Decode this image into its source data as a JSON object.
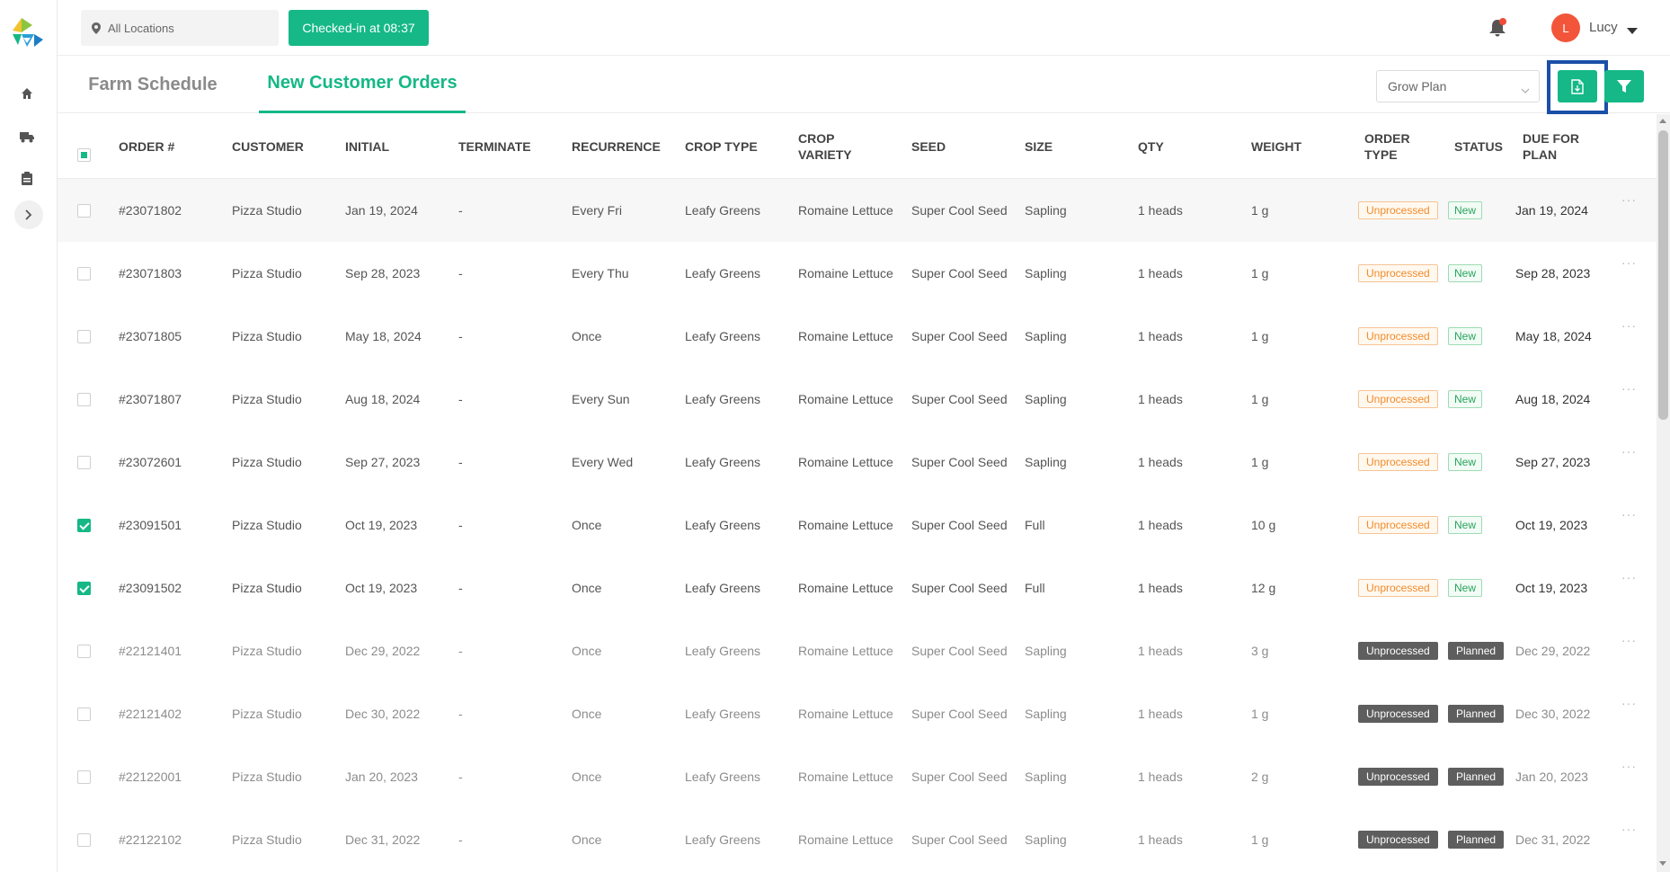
{
  "header": {
    "location_label": "All Locations",
    "checkin_label": "Checked-in at 08:37",
    "user_initial": "L",
    "user_name": "Lucy"
  },
  "tabs": [
    {
      "label": "Farm Schedule",
      "active": false
    },
    {
      "label": "New Customer Orders",
      "active": true
    }
  ],
  "toolbar": {
    "grow_plan_value": "Grow Plan"
  },
  "colors": {
    "accent": "#15b886",
    "highlight": "#1a4fa8",
    "unprocessed": "#f28c2b",
    "new": "#28a45c"
  },
  "table": {
    "headers": [
      "ORDER #",
      "CUSTOMER",
      "INITIAL",
      "TERMINATE",
      "RECURRENCE",
      "CROP TYPE",
      "CROP VARIETY",
      "SEED",
      "SIZE",
      "QTY",
      "WEIGHT",
      "ORDER TYPE",
      "STATUS",
      "DUE FOR PLAN"
    ],
    "rows": [
      {
        "order": "#23071802",
        "customer": "Pizza Studio",
        "initial": "Jan 19, 2024",
        "terminate": "-",
        "recurrence": "Every Fri",
        "crop_type": "Leafy Greens",
        "variety": "Romaine Lettuce",
        "seed": "Super Cool Seed",
        "size": "Sapling",
        "qty": "1 heads",
        "weight": "1 g",
        "order_type": "Unprocessed",
        "status": "New",
        "due": "Jan 19, 2024",
        "checked": false,
        "faded": false
      },
      {
        "order": "#23071803",
        "customer": "Pizza Studio",
        "initial": "Sep 28, 2023",
        "terminate": "-",
        "recurrence": "Every Thu",
        "crop_type": "Leafy Greens",
        "variety": "Romaine Lettuce",
        "seed": "Super Cool Seed",
        "size": "Sapling",
        "qty": "1 heads",
        "weight": "1 g",
        "order_type": "Unprocessed",
        "status": "New",
        "due": "Sep 28, 2023",
        "checked": false,
        "faded": false
      },
      {
        "order": "#23071805",
        "customer": "Pizza Studio",
        "initial": "May 18, 2024",
        "terminate": "-",
        "recurrence": "Once",
        "crop_type": "Leafy Greens",
        "variety": "Romaine Lettuce",
        "seed": "Super Cool Seed",
        "size": "Sapling",
        "qty": "1 heads",
        "weight": "1 g",
        "order_type": "Unprocessed",
        "status": "New",
        "due": "May 18, 2024",
        "checked": false,
        "faded": false
      },
      {
        "order": "#23071807",
        "customer": "Pizza Studio",
        "initial": "Aug 18, 2024",
        "terminate": "-",
        "recurrence": "Every Sun",
        "crop_type": "Leafy Greens",
        "variety": "Romaine Lettuce",
        "seed": "Super Cool Seed",
        "size": "Sapling",
        "qty": "1 heads",
        "weight": "1 g",
        "order_type": "Unprocessed",
        "status": "New",
        "due": "Aug 18, 2024",
        "checked": false,
        "faded": false
      },
      {
        "order": "#23072601",
        "customer": "Pizza Studio",
        "initial": "Sep 27, 2023",
        "terminate": "-",
        "recurrence": "Every Wed",
        "crop_type": "Leafy Greens",
        "variety": "Romaine Lettuce",
        "seed": "Super Cool Seed",
        "size": "Sapling",
        "qty": "1 heads",
        "weight": "1 g",
        "order_type": "Unprocessed",
        "status": "New",
        "due": "Sep 27, 2023",
        "checked": false,
        "faded": false
      },
      {
        "order": "#23091501",
        "customer": "Pizza Studio",
        "initial": "Oct 19, 2023",
        "terminate": "-",
        "recurrence": "Once",
        "crop_type": "Leafy Greens",
        "variety": "Romaine Lettuce",
        "seed": "Super Cool Seed",
        "size": "Full",
        "qty": "1 heads",
        "weight": "10 g",
        "order_type": "Unprocessed",
        "status": "New",
        "due": "Oct 19, 2023",
        "checked": true,
        "faded": false
      },
      {
        "order": "#23091502",
        "customer": "Pizza Studio",
        "initial": "Oct 19, 2023",
        "terminate": "-",
        "recurrence": "Once",
        "crop_type": "Leafy Greens",
        "variety": "Romaine Lettuce",
        "seed": "Super Cool Seed",
        "size": "Full",
        "qty": "1 heads",
        "weight": "12 g",
        "order_type": "Unprocessed",
        "status": "New",
        "due": "Oct 19, 2023",
        "checked": true,
        "faded": false
      },
      {
        "order": "#22121401",
        "customer": "Pizza Studio",
        "initial": "Dec 29, 2022",
        "terminate": "-",
        "recurrence": "Once",
        "crop_type": "Leafy Greens",
        "variety": "Romaine Lettuce",
        "seed": "Super Cool Seed",
        "size": "Sapling",
        "qty": "1 heads",
        "weight": "3 g",
        "order_type": "Unprocessed",
        "status": "Planned",
        "due": "Dec 29, 2022",
        "checked": false,
        "faded": true
      },
      {
        "order": "#22121402",
        "customer": "Pizza Studio",
        "initial": "Dec 30, 2022",
        "terminate": "-",
        "recurrence": "Once",
        "crop_type": "Leafy Greens",
        "variety": "Romaine Lettuce",
        "seed": "Super Cool Seed",
        "size": "Sapling",
        "qty": "1 heads",
        "weight": "1 g",
        "order_type": "Unprocessed",
        "status": "Planned",
        "due": "Dec 30, 2022",
        "checked": false,
        "faded": true
      },
      {
        "order": "#22122001",
        "customer": "Pizza Studio",
        "initial": "Jan 20, 2023",
        "terminate": "-",
        "recurrence": "Once",
        "crop_type": "Leafy Greens",
        "variety": "Romaine Lettuce",
        "seed": "Super Cool Seed",
        "size": "Sapling",
        "qty": "1 heads",
        "weight": "2 g",
        "order_type": "Unprocessed",
        "status": "Planned",
        "due": "Jan 20, 2023",
        "checked": false,
        "faded": true
      },
      {
        "order": "#22122102",
        "customer": "Pizza Studio",
        "initial": "Dec 31, 2022",
        "terminate": "-",
        "recurrence": "Once",
        "crop_type": "Leafy Greens",
        "variety": "Romaine Lettuce",
        "seed": "Super Cool Seed",
        "size": "Sapling",
        "qty": "1 heads",
        "weight": "1 g",
        "order_type": "Unprocessed",
        "status": "Planned",
        "due": "Dec 31, 2022",
        "checked": false,
        "faded": true
      }
    ]
  },
  "row_menu_glyph": "···"
}
